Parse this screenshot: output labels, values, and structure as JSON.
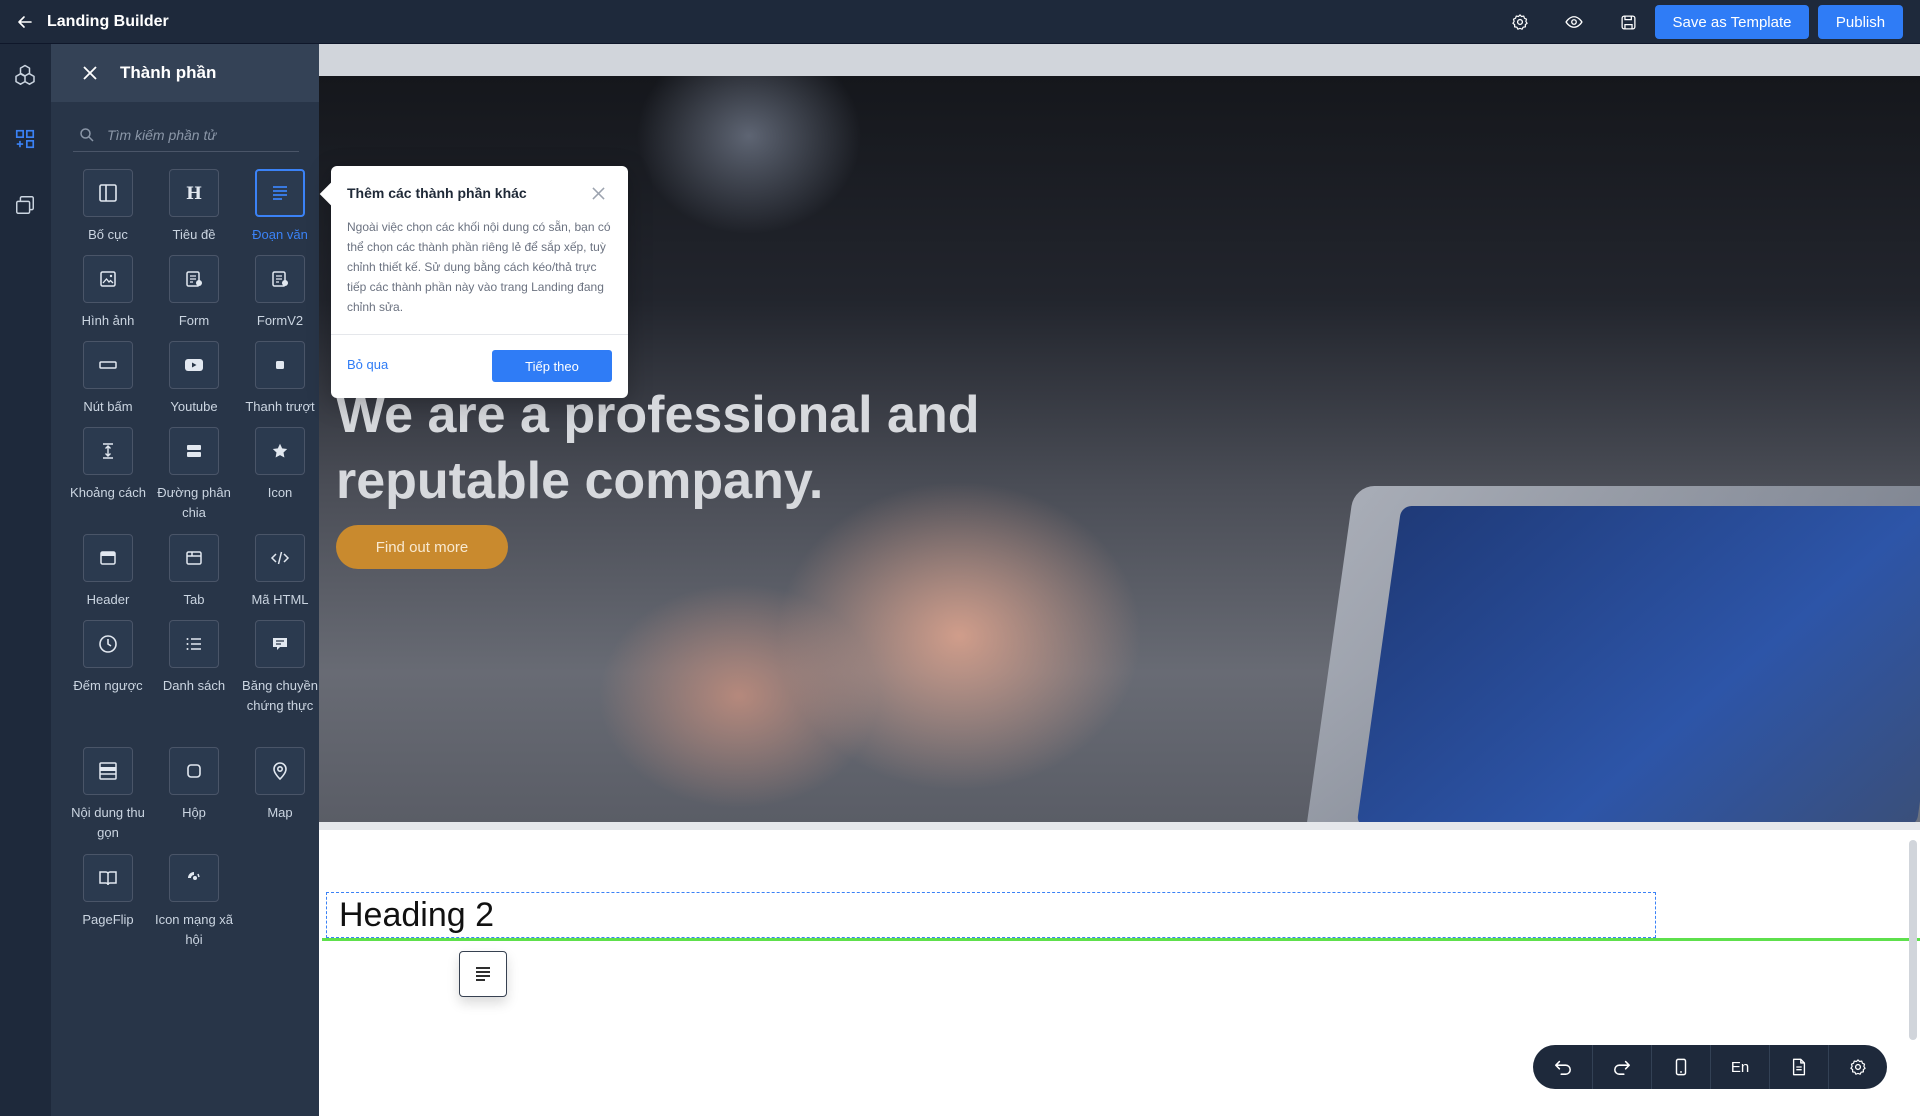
{
  "topbar": {
    "title": "Landing Builder",
    "save_template_label": "Save as Template",
    "publish_label": "Publish"
  },
  "panel": {
    "title": "Thành phần",
    "search_placeholder": "Tìm kiếm phần tử",
    "items": [
      {
        "label": "Bố cục",
        "icon": "layout-icon"
      },
      {
        "label": "Tiêu đề",
        "icon": "heading-icon"
      },
      {
        "label": "Đoạn văn",
        "icon": "paragraph-icon"
      },
      {
        "label": "Hình ảnh",
        "icon": "image-icon"
      },
      {
        "label": "Form",
        "icon": "form-icon"
      },
      {
        "label": "FormV2",
        "icon": "formv2-icon"
      },
      {
        "label": "Nút bấm",
        "icon": "button-icon"
      },
      {
        "label": "Youtube",
        "icon": "youtube-icon"
      },
      {
        "label": "Thanh trượt",
        "icon": "slider-icon"
      },
      {
        "label": "Khoảng cách",
        "icon": "spacer-icon"
      },
      {
        "label": "Đường phân chia",
        "icon": "divider-icon"
      },
      {
        "label": "Icon",
        "icon": "star-icon"
      },
      {
        "label": "Header",
        "icon": "header-icon"
      },
      {
        "label": "Tab",
        "icon": "tab-icon"
      },
      {
        "label": "Mã HTML",
        "icon": "code-icon"
      },
      {
        "label": "Đếm ngược",
        "icon": "clock-icon"
      },
      {
        "label": "Danh sách",
        "icon": "list-icon"
      },
      {
        "label": "Băng chuyền chứng thực",
        "icon": "testimonial-icon"
      },
      {
        "label": "Nội dung thu gọn",
        "icon": "accordion-icon"
      },
      {
        "label": "Hộp",
        "icon": "box-icon"
      },
      {
        "label": "Map",
        "icon": "map-pin-icon"
      },
      {
        "label": "PageFlip",
        "icon": "book-icon"
      },
      {
        "label": "Icon mạng xã hội",
        "icon": "social-icon"
      }
    ],
    "active_item": "Đoạn văn"
  },
  "popover": {
    "title": "Thêm các thành phần khác",
    "body": "Ngoài việc chọn các khối nội dung có sẵn, bạn có thể chọn các thành phần riêng lẻ để sắp xếp, tuỳ chỉnh thiết kế. Sử dụng bằng cách kéo/thả trực tiếp các thành phần này vào trang Landing đang chỉnh sửa.",
    "skip_label": "Bỏ qua",
    "next_label": "Tiếp theo"
  },
  "canvas": {
    "headline": "We are a professional and reputable company.",
    "cta_label": "Find out more",
    "heading2": "Heading 2"
  },
  "bottombar": {
    "language": "En"
  },
  "colors": {
    "accent": "#2f7cf6",
    "sidebar": "#1e293b",
    "cta": "#c98a2e",
    "dropline": "#5ee04c"
  }
}
